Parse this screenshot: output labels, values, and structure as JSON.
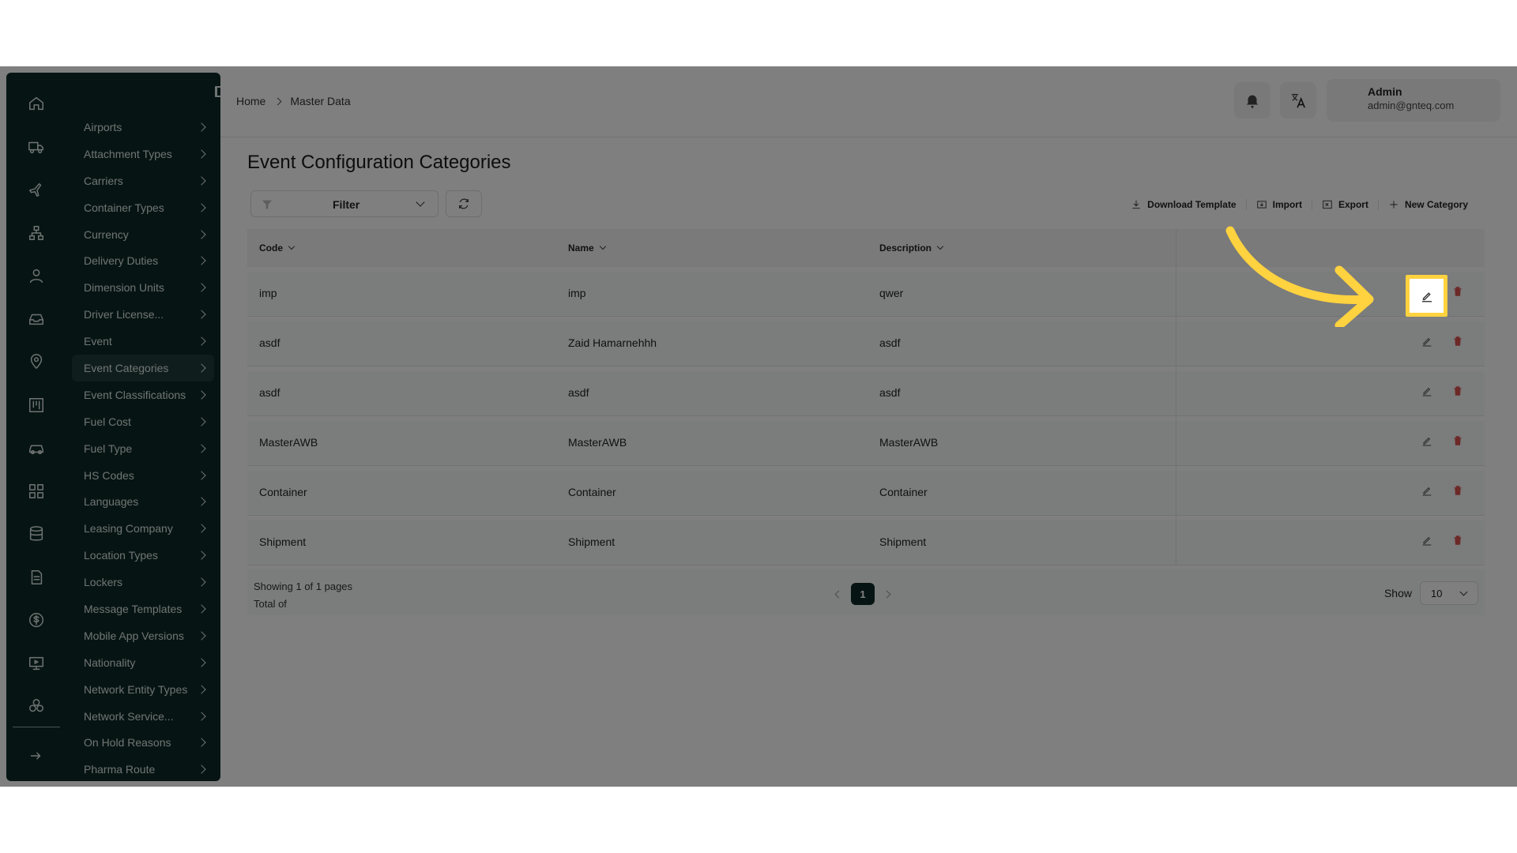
{
  "breadcrumb": {
    "home": "Home",
    "current": "Master Data"
  },
  "user": {
    "name": "Admin",
    "email": "admin@gnteq.com"
  },
  "sidebar": {
    "rail_icons": [
      "home-icon",
      "truck-icon",
      "plane-icon",
      "network-icon",
      "user-icon",
      "inbox-icon",
      "location-icon",
      "kanban-icon",
      "car-icon",
      "grid-icon",
      "database-icon",
      "document-icon",
      "dollar-icon",
      "monitor-icon",
      "boxes-icon",
      "logout-icon"
    ],
    "items": [
      {
        "label": "Airports"
      },
      {
        "label": "Attachment Types"
      },
      {
        "label": "Carriers"
      },
      {
        "label": "Container Types"
      },
      {
        "label": "Currency"
      },
      {
        "label": "Delivery Duties"
      },
      {
        "label": "Dimension Units"
      },
      {
        "label": "Driver License..."
      },
      {
        "label": "Event"
      },
      {
        "label": "Event Categories",
        "active": true
      },
      {
        "label": "Event Classifications"
      },
      {
        "label": "Fuel Cost"
      },
      {
        "label": "Fuel Type"
      },
      {
        "label": "HS Codes"
      },
      {
        "label": "Languages"
      },
      {
        "label": "Leasing Company"
      },
      {
        "label": "Location Types"
      },
      {
        "label": "Lockers"
      },
      {
        "label": "Message Templates"
      },
      {
        "label": "Mobile App Versions"
      },
      {
        "label": "Nationality"
      },
      {
        "label": "Network Entity Types"
      },
      {
        "label": "Network Service..."
      },
      {
        "label": "On Hold Reasons"
      },
      {
        "label": "Pharma Route"
      }
    ]
  },
  "page": {
    "title": "Event Configuration Categories"
  },
  "toolbar": {
    "filter_label": "Filter",
    "download_label": "Download Template",
    "import_label": "Import",
    "export_label": "Export",
    "new_label": "New Category"
  },
  "table": {
    "columns": [
      "Code",
      "Name",
      "Description"
    ],
    "rows": [
      {
        "code": "imp",
        "name": "imp",
        "description": "qwer"
      },
      {
        "code": "asdf",
        "name": "Zaid Hamarnehhh",
        "description": "asdf"
      },
      {
        "code": "asdf",
        "name": "asdf",
        "description": "asdf"
      },
      {
        "code": "MasterAWB",
        "name": "MasterAWB",
        "description": "MasterAWB"
      },
      {
        "code": "Container",
        "name": "Container",
        "description": "Container"
      },
      {
        "code": "Shipment",
        "name": "Shipment",
        "description": "Shipment"
      }
    ]
  },
  "footer": {
    "showing": "Showing 1 of 1 pages",
    "total": "Total of",
    "current_page": "1",
    "show_label": "Show",
    "page_size": "10"
  },
  "colors": {
    "sidebar_bg": "#0c2a26",
    "highlight": "#ffd23f",
    "delete_red": "#d9534f"
  }
}
